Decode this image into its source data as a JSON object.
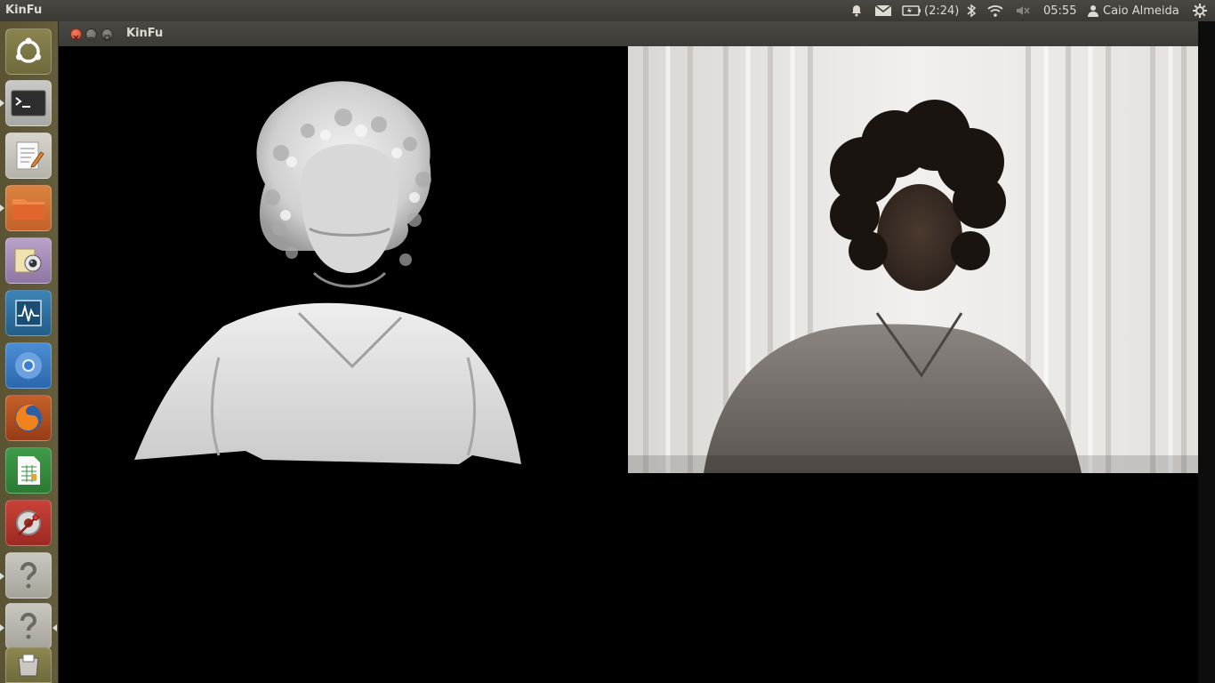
{
  "top_panel": {
    "app_name": "KinFu",
    "battery_label": "(2:24)",
    "clock": "05:55",
    "user_name": "Caio Almeida",
    "icons": [
      "bell-icon",
      "mail-icon",
      "battery-icon",
      "bluetooth-icon",
      "wifi-icon",
      "volume-muted-icon",
      "user-icon",
      "settings-gear-icon"
    ]
  },
  "launcher": {
    "items": [
      {
        "name": "ubuntu-dash",
        "icon": "ubuntu-logo-icon"
      },
      {
        "name": "terminal",
        "icon": "terminal-icon"
      },
      {
        "name": "text-editor",
        "icon": "text-editor-icon"
      },
      {
        "name": "files",
        "icon": "folder-icon"
      },
      {
        "name": "cheese-webcam",
        "icon": "webcam-icon"
      },
      {
        "name": "system-monitor",
        "icon": "system-monitor-icon"
      },
      {
        "name": "chromium",
        "icon": "chromium-icon"
      },
      {
        "name": "firefox",
        "icon": "firefox-icon"
      },
      {
        "name": "spreadsheet",
        "icon": "spreadsheet-icon"
      },
      {
        "name": "system-settings",
        "icon": "settings-wrench-icon"
      },
      {
        "name": "unknown-app-1",
        "icon": "question-icon"
      },
      {
        "name": "unknown-app-2",
        "icon": "question-icon"
      },
      {
        "name": "trash",
        "icon": "trash-icon"
      }
    ]
  },
  "window": {
    "title": "KinFu",
    "panes": [
      "3d-reconstruction-view",
      "rgb-camera-view"
    ]
  },
  "colors": {
    "panel_bg": "#3c3b37",
    "launcher_bg": "#5f5939",
    "close_button": "#e0563a"
  }
}
